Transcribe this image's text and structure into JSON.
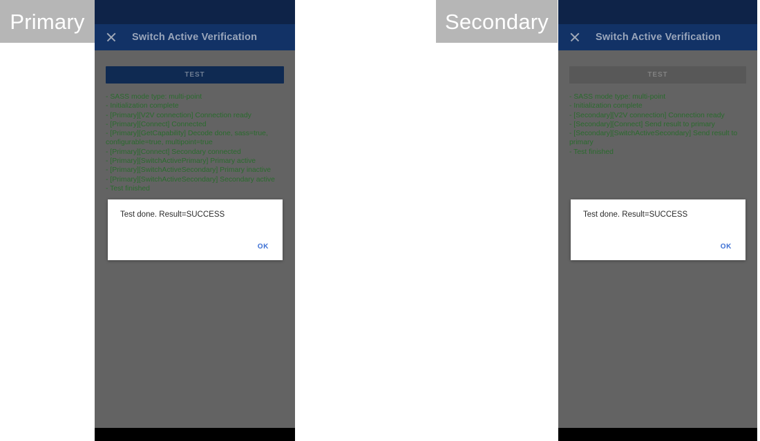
{
  "labels": {
    "primary": "Primary",
    "secondary": "Secondary"
  },
  "devices": {
    "primary": {
      "app_bar": {
        "close_icon": "close-icon",
        "title": "Switch Active Verification"
      },
      "test_button": {
        "label": "TEST",
        "state": "enabled"
      },
      "log_lines": [
        "- SASS mode type: multi-point",
        "- Initialization complete",
        "- [Primary][V2V connection] Connection ready",
        "- [Primary][Connect] Connected",
        "- [Primary][GetCapability] Decode done, sass=true, configurable=true, multipoint=true",
        "- [Primary][Connect] Secondary connected",
        "- [Primary][SwitchActivePrimary] Primary active",
        "- [Primary][SwitchActiveSecondary] Primary inactive",
        "- [Primary][SwitchActiveSecondary] Secondary active",
        "- Test finished"
      ],
      "dialog": {
        "message": "Test done. Result=SUCCESS",
        "ok_label": "OK"
      }
    },
    "secondary": {
      "app_bar": {
        "close_icon": "close-icon",
        "title": "Switch Active Verification"
      },
      "test_button": {
        "label": "TEST",
        "state": "disabled"
      },
      "log_lines": [
        "- SASS mode type: multi-point",
        "- Initialization complete",
        "- [Secondary][V2V connection] Connection ready",
        "- [Secondary][Connect] Send result to primary",
        "- [Secondary][SwitchActiveSecondary] Send result to primary",
        "- Test finished"
      ],
      "dialog": {
        "message": "Test done. Result=SUCCESS",
        "ok_label": "OK"
      }
    }
  },
  "colors": {
    "status_bar": "#0e2348",
    "app_bar": "#123266",
    "scrim": "#636363",
    "log_text": "#2a6b2d",
    "accent_ok": "#3b6fd4",
    "chip_bg": "#b6b6b6",
    "nav_bar": "#000000"
  }
}
